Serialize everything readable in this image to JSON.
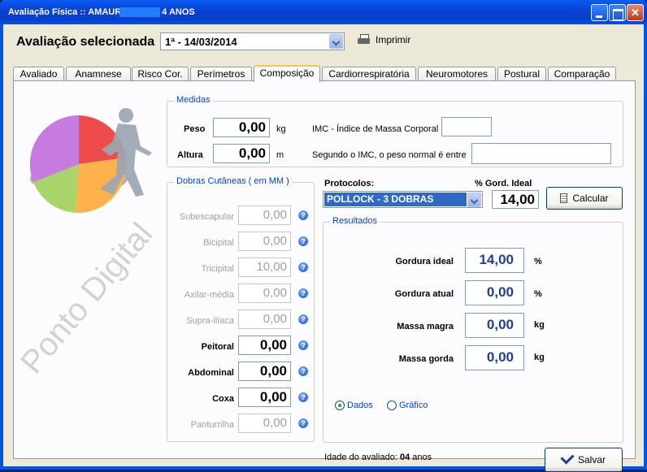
{
  "window": {
    "title_prefix": "Avaliação Física  ::  AMAUR",
    "title_suffix": "4 ANOS"
  },
  "header": {
    "selected_label": "Avaliação selecionada",
    "selected_value": "1ª - 14/03/2014",
    "print_label": "Imprimir"
  },
  "tabs": [
    "Avaliado",
    "Anamnese",
    "Risco Cor.",
    "Perímetros",
    "Composição",
    "Cardiorrespiratória",
    "Neuromotores",
    "Postural",
    "Comparação"
  ],
  "active_tab": "Composição",
  "medidas": {
    "legend": "Medidas",
    "peso_label": "Peso",
    "peso_value": "0,00",
    "peso_unit": "kg",
    "altura_label": "Altura",
    "altura_value": "0,00",
    "altura_unit": "m",
    "imc_label": "IMC - Índice de Massa Corporal",
    "imc_value": "",
    "peso_normal_label": "Segundo o IMC, o peso normal é entre",
    "peso_normal_value": ""
  },
  "dobras": {
    "legend": "Dobras Cutâneas  ( em MM )",
    "items": [
      {
        "label": "Subescapular",
        "value": "0,00"
      },
      {
        "label": "Bicipital",
        "value": "0,00"
      },
      {
        "label": "Tricipital",
        "value": "10,00"
      },
      {
        "label": "Axilar-média",
        "value": "0,00"
      },
      {
        "label": "Supra-ilíaca",
        "value": "0,00"
      },
      {
        "label": "Peitoral",
        "value": "0,00"
      },
      {
        "label": "Abdominal",
        "value": "0,00"
      },
      {
        "label": "Coxa",
        "value": "0,00"
      },
      {
        "label": "Panturrilha",
        "value": "0,00"
      }
    ],
    "help_glyph": "?"
  },
  "protocolo": {
    "label": "Protocolos:",
    "value": "POLLOCK - 3 DOBRAS",
    "gord_ideal_label": "% Gord. Ideal",
    "gord_ideal_value": "14,00",
    "calc_label": "Calcular"
  },
  "resultados": {
    "legend": "Resultados",
    "items": [
      {
        "label": "Gordura ideal",
        "value": "14,00",
        "unit": "%"
      },
      {
        "label": "Gordura atual",
        "value": "0,00",
        "unit": "%"
      },
      {
        "label": "Massa magra",
        "value": "0,00",
        "unit": "kg"
      },
      {
        "label": "Massa gorda",
        "value": "0,00",
        "unit": "kg"
      }
    ],
    "radio_dados": "Dados",
    "radio_grafico": "Gráfico"
  },
  "footer": {
    "idade_label": "Idade do avaliado:",
    "idade_value": "04",
    "idade_unit": "anos",
    "save_label": "Salvar"
  },
  "watermark": "Ponto Digital",
  "colors": {
    "accent": "#0046d5",
    "result_text": "#1c3f98",
    "selection": "#316ac5"
  }
}
